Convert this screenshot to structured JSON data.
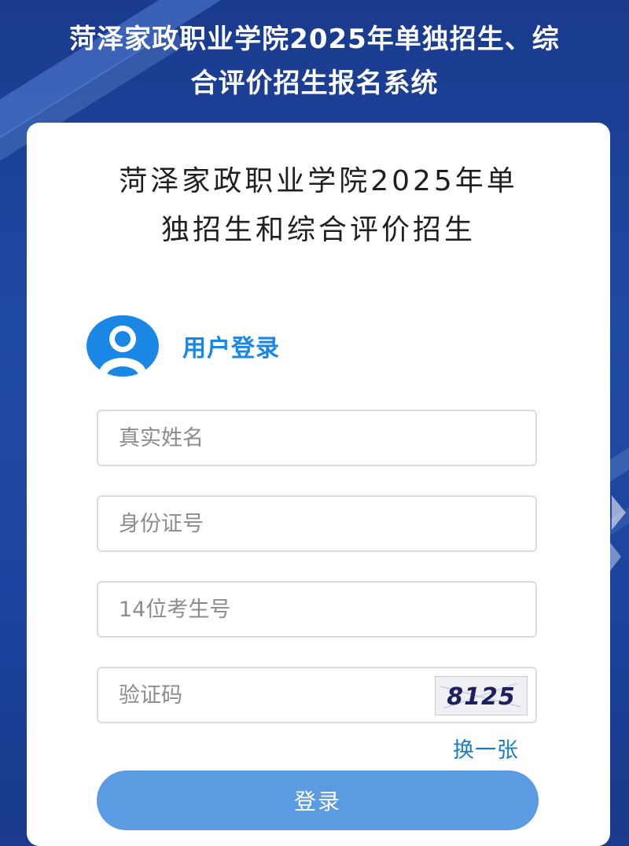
{
  "header": {
    "title_line1": "菏泽家政职业学院2025年单独招生、综",
    "title_line2": "合评价招生报名系统"
  },
  "card": {
    "title_line1": "菏泽家政职业学院2025年单",
    "title_line2": "独招生和综合评价招生",
    "login_label": "用户登录"
  },
  "form": {
    "name_placeholder": "真实姓名",
    "id_placeholder": "身份证号",
    "exam_placeholder": "14位考生号",
    "captcha_placeholder": "验证码",
    "captcha_code": "8125",
    "refresh_label": "换一张",
    "submit_label": "登录"
  },
  "colors": {
    "background": "#1f4aa3",
    "accent": "#1a86e6",
    "button": "#5b9be2",
    "link": "#1a7fc1"
  },
  "icons": {
    "avatar": "user-avatar-icon"
  }
}
